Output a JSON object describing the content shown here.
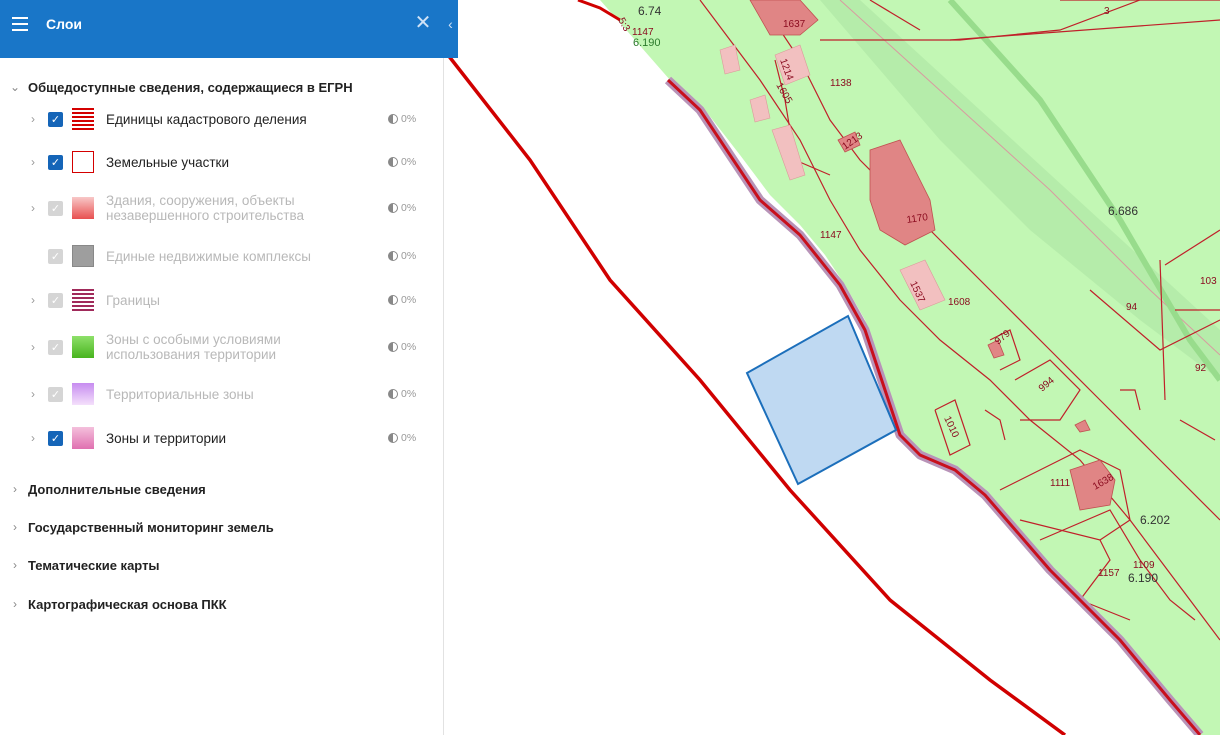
{
  "panel": {
    "title": "Слои",
    "close_glyph": "✕",
    "collapse_glyph": "‹",
    "groups": [
      {
        "label": "Общедоступные сведения, содержащиеся в ЕГРН",
        "expanded": true,
        "layers": [
          {
            "name": "Единицы кадастрового деления",
            "checked": true,
            "disabled": false,
            "has_children": true,
            "opacity": "0%",
            "swatch": "red-stripes"
          },
          {
            "name": "Земельные участки",
            "checked": true,
            "disabled": false,
            "has_children": true,
            "opacity": "0%",
            "swatch": "red-outline"
          },
          {
            "name": "Здания, сооружения, объекты незавершенного строительства",
            "checked": true,
            "disabled": true,
            "has_children": true,
            "opacity": "0%",
            "swatch": "pink-fill"
          },
          {
            "name": "Единые недвижимые комплексы",
            "checked": true,
            "disabled": true,
            "has_children": false,
            "opacity": "0%",
            "swatch": "gray-hatch"
          },
          {
            "name": "Границы",
            "checked": true,
            "disabled": true,
            "has_children": true,
            "opacity": "0%",
            "swatch": "purple-stripes"
          },
          {
            "name": "Зоны с особыми условиями использования территории",
            "checked": true,
            "disabled": true,
            "has_children": true,
            "opacity": "0%",
            "swatch": "green-fill"
          },
          {
            "name": "Территориальные зоны",
            "checked": true,
            "disabled": true,
            "has_children": true,
            "opacity": "0%",
            "swatch": "violet-fill"
          },
          {
            "name": "Зоны и территории",
            "checked": true,
            "disabled": false,
            "has_children": true,
            "opacity": "0%",
            "swatch": "magenta-fill"
          }
        ]
      },
      {
        "label": "Дополнительные сведения",
        "expanded": false
      },
      {
        "label": "Государственный мониторинг земель",
        "expanded": false
      },
      {
        "label": "Тематические карты",
        "expanded": false
      },
      {
        "label": "Картографическая основа ПКК",
        "expanded": false
      }
    ]
  },
  "map": {
    "labels": {
      "l674": "6.74",
      "l1147a": "1147",
      "l6190a": "6.190",
      "l53": "5:3",
      "l1637": "1637",
      "l3": "3",
      "l1214": "1214",
      "l1605": "1605",
      "l1138": "1138",
      "l1213": "1213",
      "l1170": "1170",
      "l6686": "6.686",
      "l1147b": "1147",
      "l1537": "1537",
      "l1608": "1608",
      "l103": "103",
      "l94": "94",
      "l979": "979",
      "l92": "92",
      "l994": "994",
      "l1010": "1010",
      "l1111": "1111",
      "l1638": "1638",
      "l6202": "6.202",
      "l1109": "1109",
      "l1157": "1157",
      "l6190b": "6.190"
    },
    "colors": {
      "land": "#c2f7b4",
      "parcel_line": "#c0202a",
      "boundary": "#cc0000",
      "boundary_halo": "#b893b8",
      "building": "#e08080",
      "selection_fill": "#bfd9f2",
      "selection_stroke": "#1c6fbb",
      "road_band": "#a8e6a0"
    }
  }
}
